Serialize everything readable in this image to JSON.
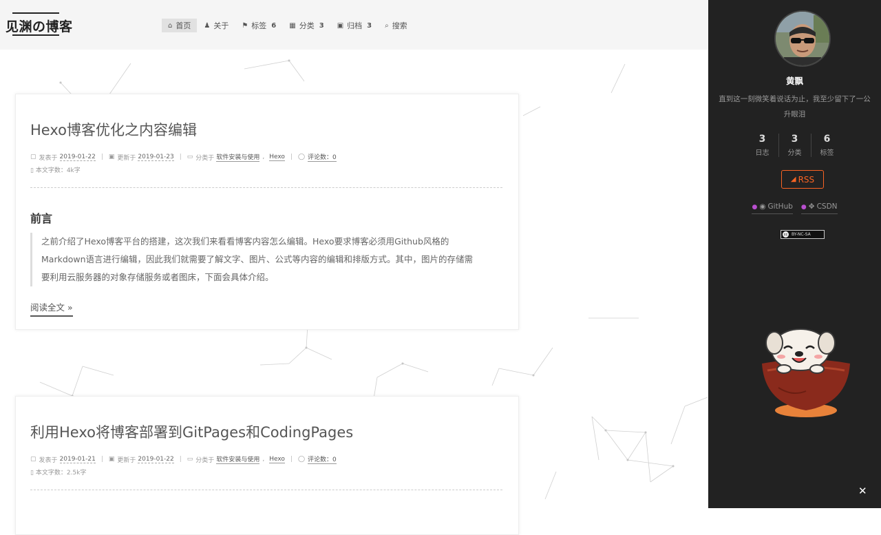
{
  "header": {
    "logo": "见渊の博客",
    "nav": [
      {
        "icon": "⌂",
        "label": "首页",
        "badge": ""
      },
      {
        "icon": "♟",
        "label": "关于",
        "badge": ""
      },
      {
        "icon": "⚑",
        "label": "标签",
        "badge": "6"
      },
      {
        "icon": "▦",
        "label": "分类",
        "badge": "3"
      },
      {
        "icon": "▣",
        "label": "归档",
        "badge": "3"
      },
      {
        "icon": "⌕",
        "label": "搜索",
        "badge": ""
      }
    ]
  },
  "posts": [
    {
      "title": "Hexo博客优化之内容编辑",
      "posted_label": "发表于",
      "posted_date": "2019-01-22",
      "updated_label": "更新于",
      "updated_date": "2019-01-23",
      "category_label": "分类于",
      "category_main": "软件安装与使用",
      "category_sub": "Hexo",
      "comments_label": "评论数：",
      "comments_count": "0",
      "wordcount": "本文字数：4k字",
      "section_title": "前言",
      "excerpt_line1": "之前介绍了Hexo博客平台的搭建，这次我们来看看博客内容怎么编辑。Hexo要求博客必须用Github风格的",
      "excerpt_line2": "Markdown语言进行编辑，因此我们就需要了解文字、图片、公式等内容的编辑和排版方式。其中，图片的存储需",
      "excerpt_line3": "要利用云服务器的对象存储服务或者图床，下面会具体介绍。",
      "read_more": "阅读全文 »"
    },
    {
      "title": "利用Hexo将博客部署到GitPages和CodingPages",
      "posted_label": "发表于",
      "posted_date": "2019-01-21",
      "updated_label": "更新于",
      "updated_date": "2019-01-22",
      "category_label": "分类于",
      "category_main": "软件安装与使用",
      "category_sub": "Hexo",
      "comments_label": "评论数：",
      "comments_count": "0",
      "wordcount": "本文字数：2.5k字"
    }
  ],
  "sidebar": {
    "author": "黄飘",
    "description_line1": "直到这一刻微笑着说话为止，我至少留下了一公",
    "description_line2": "升眼泪",
    "stats": [
      {
        "count": "3",
        "label": "日志"
      },
      {
        "count": "3",
        "label": "分类"
      },
      {
        "count": "6",
        "label": "标签"
      }
    ],
    "rss": "RSS",
    "links": [
      {
        "icon": "github-icon",
        "label": "GitHub"
      },
      {
        "icon": "csdn-icon",
        "label": "CSDN"
      }
    ],
    "license": "BY-NC-SA",
    "close": "✕"
  },
  "colors": {
    "accent": "#fc6423",
    "sidebar_bg": "#222222",
    "link_dot": "#b94fcf"
  }
}
